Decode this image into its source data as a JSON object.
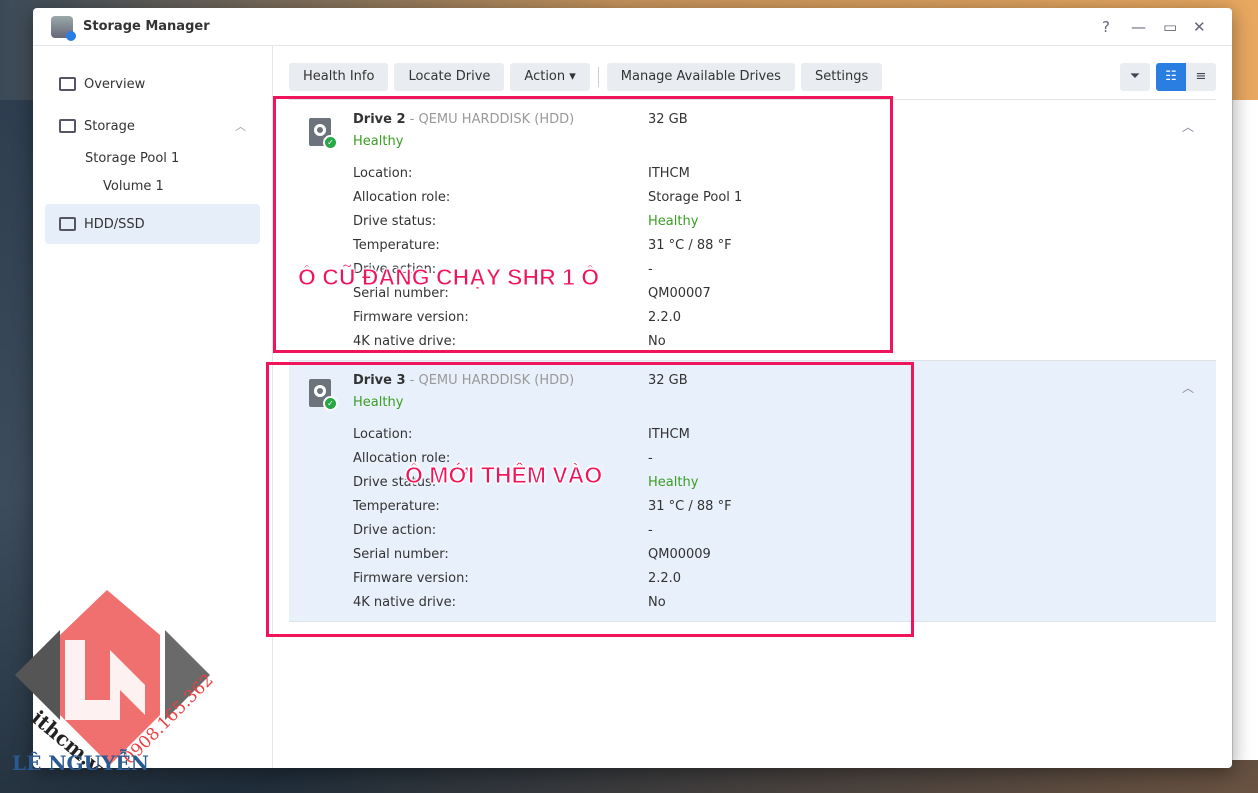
{
  "window": {
    "title": "Storage Manager",
    "help": "?",
    "minimize": "—",
    "maximize": "▭",
    "close": "✕"
  },
  "sidebar": {
    "items": [
      {
        "label": "Overview"
      },
      {
        "label": "Storage"
      },
      {
        "label": "Storage Pool 1"
      },
      {
        "label": "Volume 1"
      },
      {
        "label": "HDD/SSD"
      }
    ]
  },
  "toolbar": {
    "health_info": "Health Info",
    "locate_drive": "Locate Drive",
    "action": "Action ▾",
    "manage": "Manage Available Drives",
    "settings": "Settings"
  },
  "colors": {
    "accent": "#2a7de1",
    "healthy": "#3a9d23",
    "annotation": "#f0145a"
  },
  "labels": {
    "location": "Location:",
    "allocation": "Allocation role:",
    "status": "Drive status:",
    "temperature": "Temperature:",
    "action": "Drive action:",
    "serial": "Serial number:",
    "firmware": "Firmware version:",
    "native4k": "4K native drive:"
  },
  "drives": [
    {
      "name": "Drive 2",
      "model": " - QEMU HARDDISK (HDD)",
      "size": "32 GB",
      "health": "Healthy",
      "location": "ITHCM",
      "allocation": "Storage Pool 1",
      "status": "Healthy",
      "temperature": "31 °C / 88 °F",
      "action": "-",
      "serial": "QM00007",
      "firmware": "2.2.0",
      "native4k": "No"
    },
    {
      "name": "Drive 3",
      "model": " - QEMU HARDDISK (HDD)",
      "size": "32 GB",
      "health": "Healthy",
      "location": "ITHCM",
      "allocation": "-",
      "status": "Healthy",
      "temperature": "31 °C / 88 °F",
      "action": "-",
      "serial": "QM00009",
      "firmware": "2.2.0",
      "native4k": "No"
    }
  ],
  "annotations": {
    "old": "Ổ CŨ ĐANG CHẠY SHR 1 Ổ",
    "new": "Ổ MỚI THÊM VÀO"
  },
  "watermark": {
    "site": "ithcm.vn",
    "phone": "0908.165.362",
    "brand": "LÊ NGUYỄN"
  }
}
